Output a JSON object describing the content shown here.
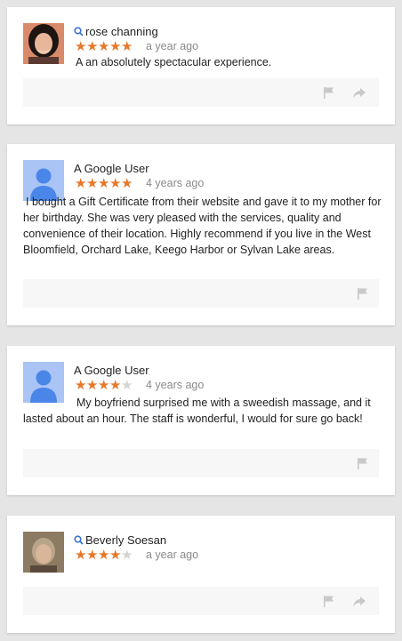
{
  "colors": {
    "star_on": "#e6782a",
    "star_off": "#d3d3d3",
    "icon_gray": "#c8c8c8",
    "avatar_blue": "#4a86e8"
  },
  "reviews": [
    {
      "author": "rose channing",
      "avatar": "photo",
      "show_search_icon": true,
      "rating": 5,
      "time": "a year ago",
      "text": "A an absolutely spectacular experience.",
      "actions": [
        "flag-icon",
        "share-icon"
      ]
    },
    {
      "author": "A Google User",
      "avatar": "default-user",
      "show_search_icon": false,
      "rating": 5,
      "time": "4 years ago",
      "text": "I bought a Gift Certificate from their website and gave it to my mother for her birthday. She was very pleased with the services, quality and convenience of their location. Highly recommend if you live in the West Bloomfield, Orchard Lake, Keego Harbor or Sylvan Lake areas.",
      "actions": [
        "flag-icon"
      ]
    },
    {
      "author": "A Google User",
      "avatar": "default-user",
      "show_search_icon": false,
      "rating": 4,
      "time": "4 years ago",
      "text": "My boyfriend surprised me with a sweedish massage, and it lasted about an hour. The staff is wonderful, I would for sure go back!",
      "actions": [
        "flag-icon"
      ]
    },
    {
      "author": "Beverly Soesan",
      "avatar": "photo",
      "show_search_icon": true,
      "rating": 4,
      "time": "a year ago",
      "text": "",
      "actions": [
        "flag-icon",
        "share-icon"
      ]
    }
  ]
}
